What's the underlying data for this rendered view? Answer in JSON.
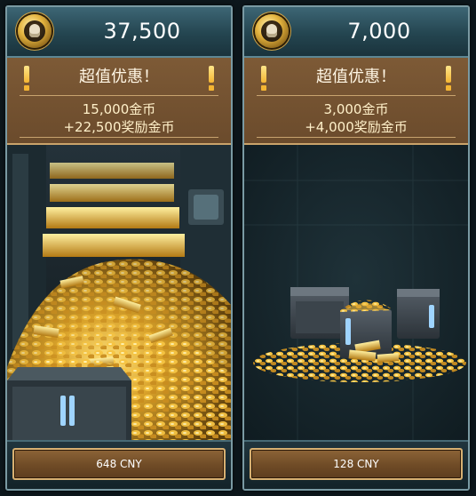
{
  "packs": [
    {
      "coins": "37,500",
      "promo_title": "超值优惠！",
      "base_coins": "15,000金币",
      "bonus_coins": "+22,500奖励金币",
      "price": "648 CNY",
      "art": "gold-vault-illustration"
    },
    {
      "coins": "7,000",
      "promo_title": "超值优惠！",
      "base_coins": "3,000金币",
      "bonus_coins": "+4,000奖励金币",
      "price": "128 CNY",
      "art": "gold-crates-illustration"
    }
  ],
  "colors": {
    "header": "#2e5563",
    "promo": "#7a5734",
    "accent_gold": "#f4b533",
    "button_border": "#d7b071"
  },
  "icons": {
    "currency": "gold-coin-icon",
    "promo_marker": "exclamation-icon"
  }
}
